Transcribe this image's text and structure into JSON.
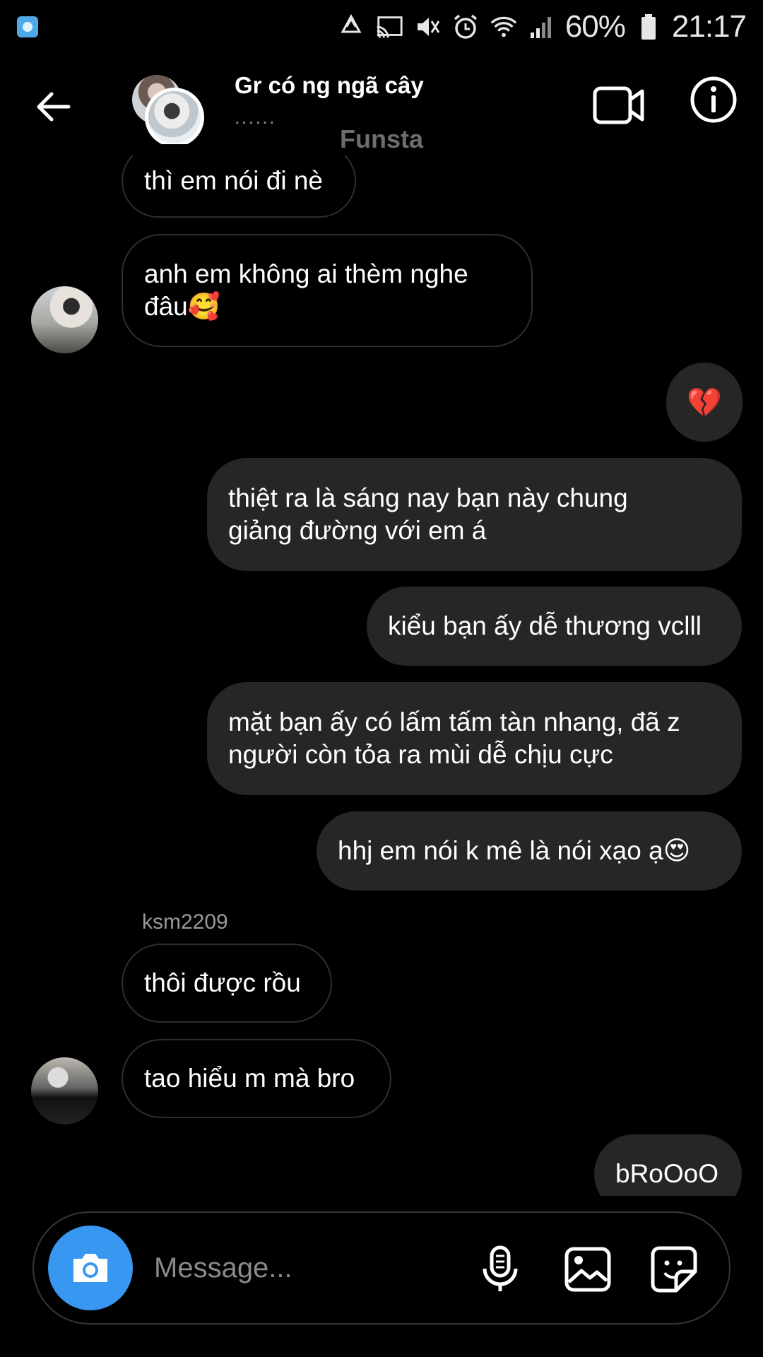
{
  "status_bar": {
    "battery": "60%",
    "time": "21:17"
  },
  "header": {
    "title": "Gr có ng ngã cây",
    "subtitle": "......"
  },
  "watermark": "Funsta",
  "messages": [
    {
      "direction": "in",
      "text": "thì em nói đi nè"
    },
    {
      "direction": "in",
      "text": "anh em không ai thèm nghe\nđâu🥰"
    },
    {
      "direction": "out",
      "text": "💔"
    },
    {
      "direction": "out",
      "text": "thiệt ra là sáng nay bạn này chung\ngiảng đường với em á"
    },
    {
      "direction": "out",
      "text": "kiểu bạn ấy dễ thương vclll"
    },
    {
      "direction": "out",
      "text": "mặt bạn ấy có lấm tấm tàn nhang, đã z\nngười còn tỏa ra mùi dễ chịu cực"
    },
    {
      "direction": "out",
      "text": "hhj em nói k mê là nói xạo ạ😍"
    },
    {
      "direction": "in",
      "sender": "ksm2209",
      "text": "thôi được rồu"
    },
    {
      "direction": "in",
      "text": "tao hiểu m mà bro"
    },
    {
      "direction": "out",
      "text": "bRoOoO"
    }
  ],
  "composer": {
    "placeholder": "Message..."
  },
  "colors": {
    "background": "#000000",
    "outgoing_bubble": "#262626",
    "incoming_border": "#2e2e2e",
    "camera_button": "#3897f0"
  },
  "icons": [
    "back-arrow-icon",
    "video-call-icon",
    "info-icon",
    "camera-icon",
    "microphone-icon",
    "gallery-icon",
    "sticker-icon"
  ]
}
